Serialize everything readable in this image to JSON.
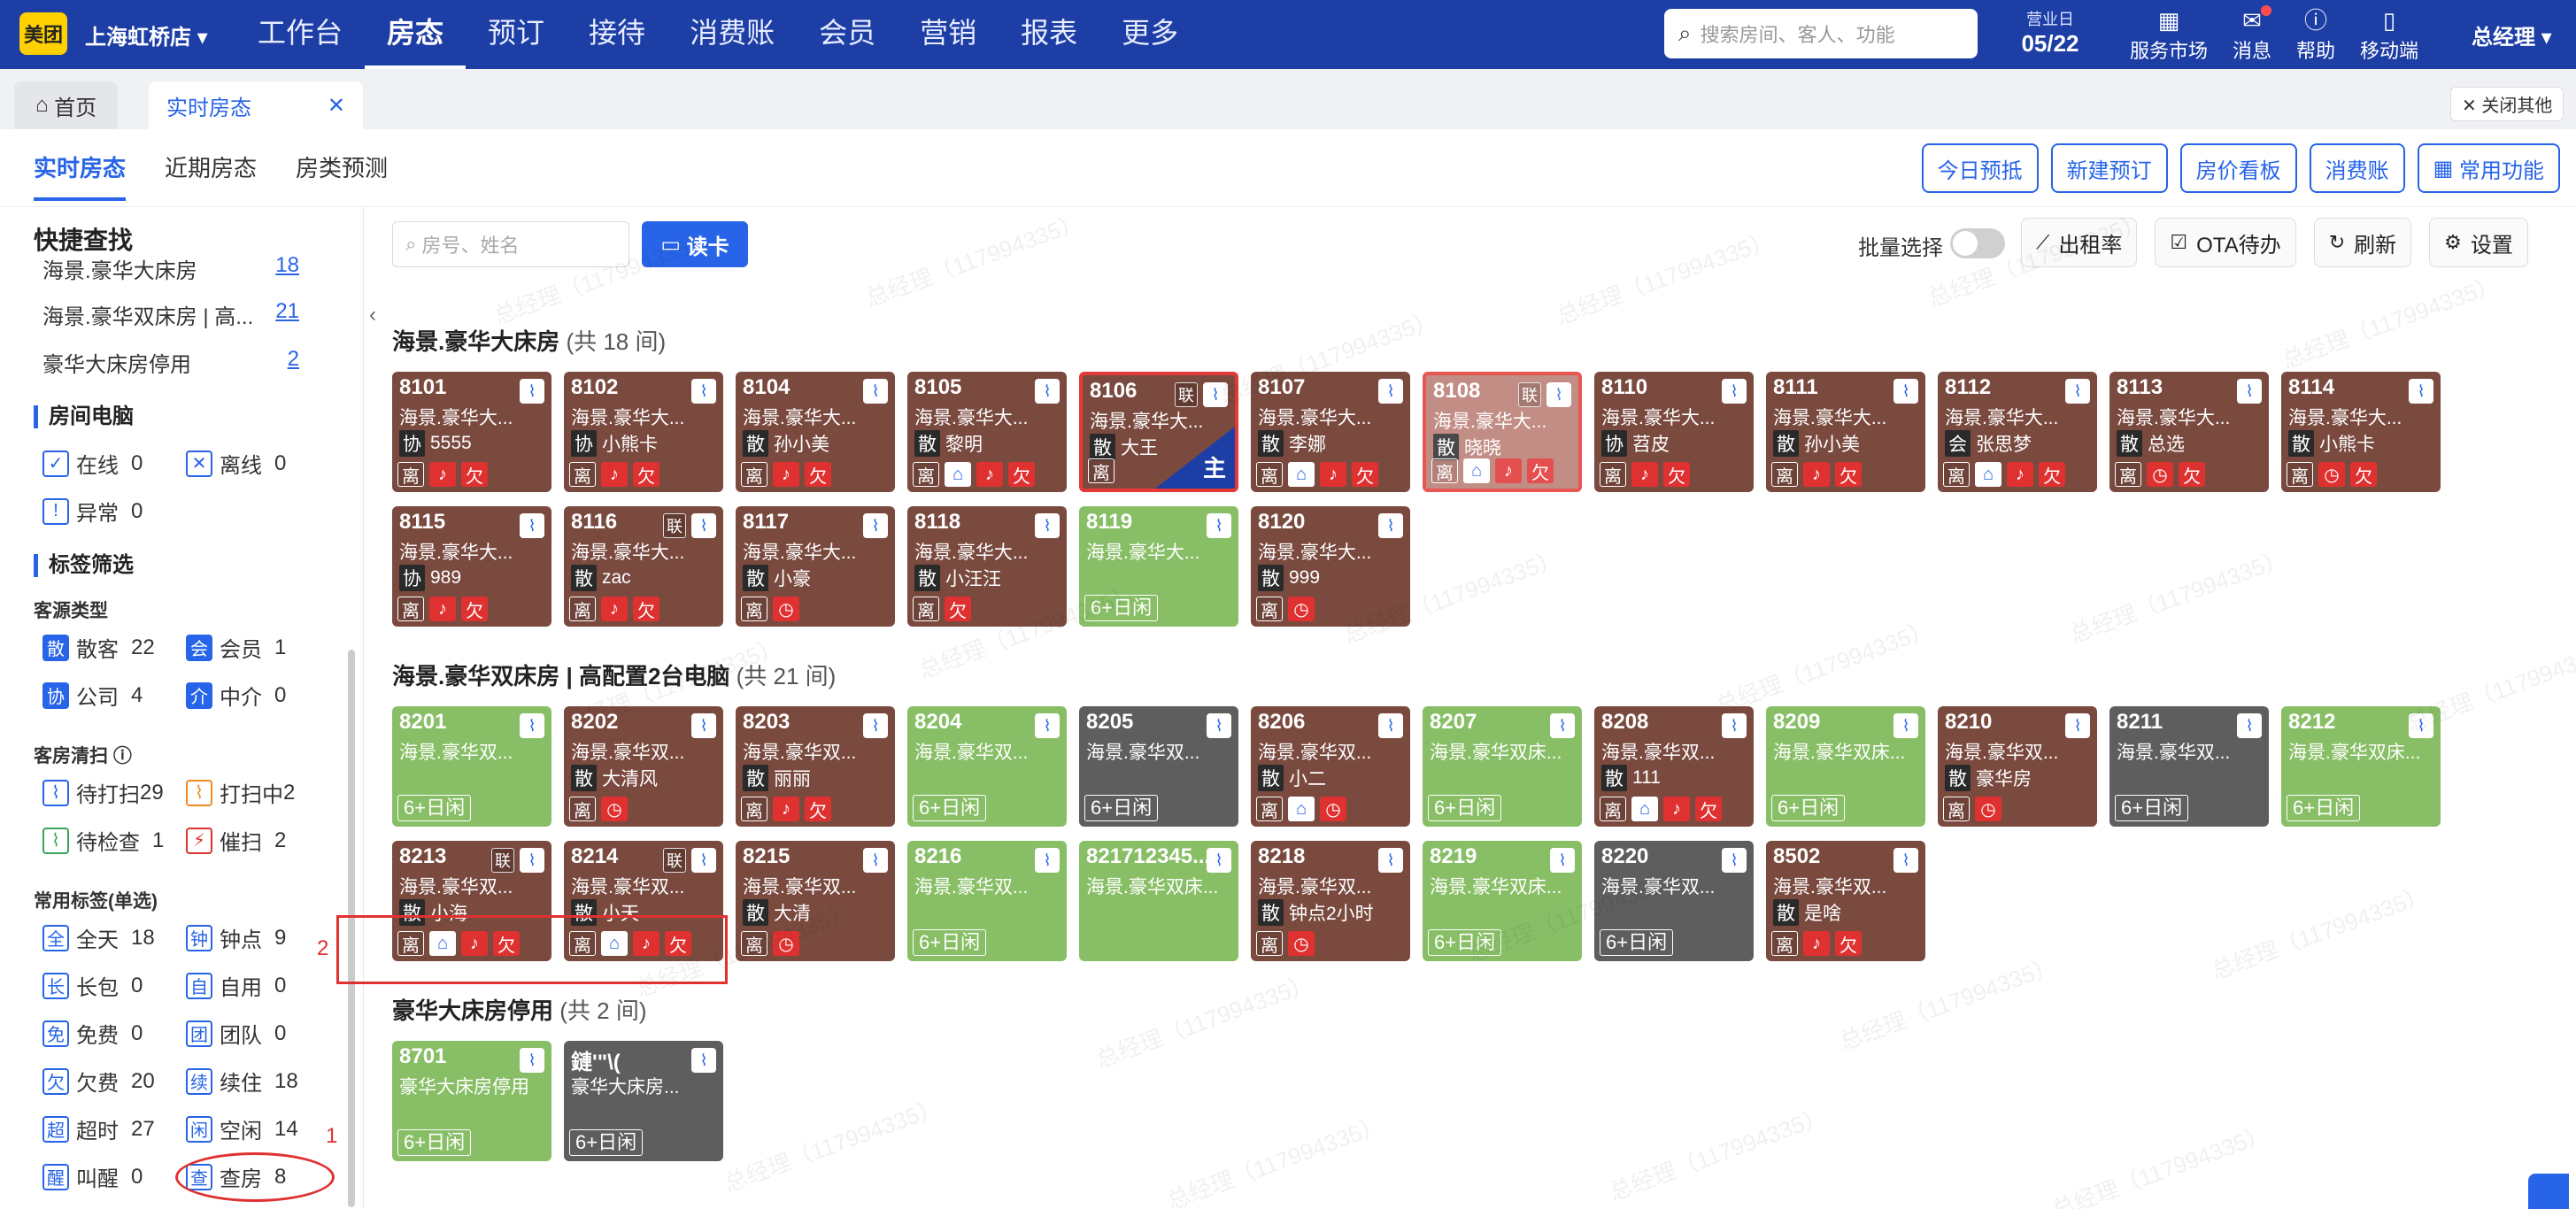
{
  "topbar": {
    "logo": "美团",
    "store": "上海虹桥店",
    "nav": [
      "工作台",
      "房态",
      "预订",
      "接待",
      "消费账",
      "会员",
      "营销",
      "报表",
      "更多"
    ],
    "search_placeholder": "搜索房间、客人、功能",
    "bizday_label": "营业日",
    "bizday": "05/22",
    "tools": [
      "服务市场",
      "消息",
      "帮助",
      "移动端"
    ],
    "user": "总经理"
  },
  "tabs": {
    "home": "首页",
    "current": "实时房态",
    "close_all": "关闭其他"
  },
  "subtabs": [
    "实时房态",
    "近期房态",
    "房类预测"
  ],
  "actions": [
    "今日预抵",
    "新建预订",
    "房价看板",
    "消费账",
    "常用功能"
  ],
  "side": {
    "title": "快捷查找",
    "quick": [
      {
        "name": "海景.豪华大床房",
        "n": "18"
      },
      {
        "name": "海景.豪华双床房 | 高...",
        "n": "21"
      },
      {
        "name": "豪华大床房停用",
        "n": "2"
      }
    ],
    "pc_title": "房间电脑",
    "pc": [
      {
        "t": "在线",
        "v": "0"
      },
      {
        "t": "离线",
        "v": "0"
      },
      {
        "t": "异常",
        "v": "0"
      }
    ],
    "tag_title": "标签筛选",
    "src_title": "客源类型",
    "src": [
      {
        "b": "散",
        "t": "散客",
        "v": "22"
      },
      {
        "b": "会",
        "t": "会员",
        "v": "1"
      },
      {
        "b": "协",
        "t": "公司",
        "v": "4"
      },
      {
        "b": "介",
        "t": "中介",
        "v": "0"
      }
    ],
    "clean_title": "客房清扫",
    "clean": [
      {
        "t": "待打扫",
        "v": "29"
      },
      {
        "t": "打扫中",
        "v": "2"
      },
      {
        "t": "待检查",
        "v": "1"
      },
      {
        "t": "催扫",
        "v": "2"
      }
    ],
    "common_title": "常用标签(单选)",
    "common": [
      {
        "b": "全",
        "t": "全天",
        "v": "18"
      },
      {
        "b": "钟",
        "t": "钟点",
        "v": "9"
      },
      {
        "b": "长",
        "t": "长包",
        "v": "0"
      },
      {
        "b": "自",
        "t": "自用",
        "v": "0"
      },
      {
        "b": "免",
        "t": "免费",
        "v": "0"
      },
      {
        "b": "团",
        "t": "团队",
        "v": "0"
      },
      {
        "b": "欠",
        "t": "欠费",
        "v": "20"
      },
      {
        "b": "续",
        "t": "续住",
        "v": "18"
      },
      {
        "b": "超",
        "t": "超时",
        "v": "27"
      },
      {
        "b": "闲",
        "t": "空闲",
        "v": "14"
      },
      {
        "b": "醒",
        "t": "叫醒",
        "v": "0"
      },
      {
        "b": "查",
        "t": "查房",
        "v": "8"
      }
    ]
  },
  "toolbar": {
    "search_placeholder": "房号、姓名",
    "read_card": "读卡",
    "batch": "批量选择",
    "buttons": [
      "出租率",
      "OTA待办",
      "刷新",
      "设置"
    ]
  },
  "groups": [
    {
      "name": "海景.豪华大床房",
      "count": "(共 18 间)"
    },
    {
      "name": "海景.豪华双床房 | 高配置2台电脑",
      "count": "(共 21 间)"
    },
    {
      "name": "豪华大床房停用",
      "count": "(共 2 间)"
    }
  ],
  "rooms": [
    {
      "num": "8101",
      "typ": "海景.豪华大...",
      "src": "协",
      "guest": "5555",
      "tags": [
        "离",
        "铃",
        "欠"
      ],
      "c": "brown",
      "x": 0,
      "y": 0
    },
    {
      "num": "8102",
      "typ": "海景.豪华大...",
      "src": "协",
      "guest": "小熊卡",
      "tags": [
        "离",
        "铃",
        "欠"
      ],
      "c": "brown",
      "x": 1,
      "y": 0
    },
    {
      "num": "8104",
      "typ": "海景.豪华大...",
      "src": "散",
      "guest": "孙小美",
      "tags": [
        "离",
        "铃",
        "欠"
      ],
      "c": "brown",
      "x": 2,
      "y": 0
    },
    {
      "num": "8105",
      "typ": "海景.豪华大...",
      "src": "散",
      "guest": "黎明",
      "tags": [
        "离",
        "家",
        "铃",
        "欠"
      ],
      "c": "brown",
      "x": 3,
      "y": 0
    },
    {
      "num": "8106",
      "typ": "海景.豪华大...",
      "src": "散",
      "guest": "大王",
      "tags": [
        "离"
      ],
      "c": "brown red",
      "x": 4,
      "y": 0,
      "lian": "联",
      "zhu": "主"
    },
    {
      "num": "8107",
      "typ": "海景.豪华大...",
      "src": "散",
      "guest": "李娜",
      "tags": [
        "离",
        "家",
        "铃",
        "欠"
      ],
      "c": "brown",
      "x": 5,
      "y": 0
    },
    {
      "num": "8108",
      "typ": "海景.豪华大...",
      "src": "散",
      "guest": "晓晓",
      "tags": [
        "离",
        "家",
        "铃",
        "欠"
      ],
      "c": "fade red",
      "x": 6,
      "y": 0,
      "lian": "联"
    },
    {
      "num": "8110",
      "typ": "海景.豪华大...",
      "src": "协",
      "guest": "苕皮",
      "tags": [
        "离",
        "铃",
        "欠"
      ],
      "c": "brown",
      "x": 7,
      "y": 0
    },
    {
      "num": "8111",
      "typ": "海景.豪华大...",
      "src": "散",
      "guest": "孙小美",
      "tags": [
        "离",
        "铃",
        "欠"
      ],
      "c": "brown",
      "x": 8,
      "y": 0
    },
    {
      "num": "8112",
      "typ": "海景.豪华大...",
      "src": "会",
      "guest": "张思梦",
      "tags": [
        "离",
        "家",
        "铃",
        "欠"
      ],
      "c": "brown",
      "x": 9,
      "y": 0
    },
    {
      "num": "8113",
      "typ": "海景.豪华大...",
      "src": "散",
      "guest": "总选",
      "tags": [
        "离",
        "钟",
        "欠"
      ],
      "c": "brown",
      "x": 10,
      "y": 0
    },
    {
      "num": "8114",
      "typ": "海景.豪华大...",
      "src": "散",
      "guest": "小熊卡",
      "tags": [
        "离",
        "钟",
        "欠"
      ],
      "c": "brown",
      "x": 11,
      "y": 0
    },
    {
      "num": "8115",
      "typ": "海景.豪华大...",
      "src": "协",
      "guest": "989",
      "tags": [
        "离",
        "铃",
        "欠"
      ],
      "c": "brown",
      "x": 0,
      "y": 1
    },
    {
      "num": "8116",
      "typ": "海景.豪华大...",
      "src": "散",
      "guest": "zac",
      "tags": [
        "离",
        "铃",
        "欠"
      ],
      "c": "brown",
      "x": 1,
      "y": 1,
      "lian": "联"
    },
    {
      "num": "8117",
      "typ": "海景.豪华大...",
      "src": "散",
      "guest": "小豪",
      "tags": [
        "离",
        "钟"
      ],
      "c": "brown",
      "x": 2,
      "y": 1
    },
    {
      "num": "8118",
      "typ": "海景.豪华大...",
      "src": "散",
      "guest": "小汪汪",
      "tags": [
        "离",
        "欠"
      ],
      "c": "brown",
      "x": 3,
      "y": 1
    },
    {
      "num": "8119",
      "typ": "海景.豪华大...",
      "idle": "6+日闲",
      "c": "green",
      "x": 4,
      "y": 1
    },
    {
      "num": "8120",
      "typ": "海景.豪华大...",
      "src": "散",
      "guest": "999",
      "tags": [
        "离",
        "钟"
      ],
      "c": "brown",
      "x": 5,
      "y": 1
    },
    {
      "num": "8201",
      "typ": "海景.豪华双...",
      "idle": "6+日闲",
      "c": "green",
      "x": 0,
      "y": 2
    },
    {
      "num": "8202",
      "typ": "海景.豪华双...",
      "src": "散",
      "guest": "大清风",
      "tags": [
        "离",
        "钟"
      ],
      "c": "brown",
      "x": 1,
      "y": 2
    },
    {
      "num": "8203",
      "typ": "海景.豪华双...",
      "src": "散",
      "guest": "丽丽",
      "tags": [
        "离",
        "铃",
        "欠"
      ],
      "c": "brown",
      "x": 2,
      "y": 2
    },
    {
      "num": "8204",
      "typ": "海景.豪华双...",
      "idle": "6+日闲",
      "c": "green",
      "x": 3,
      "y": 2
    },
    {
      "num": "8205",
      "typ": "海景.豪华双...",
      "idle": "6+日闲",
      "c": "gray",
      "x": 4,
      "y": 2
    },
    {
      "num": "8206",
      "typ": "海景.豪华双...",
      "src": "散",
      "guest": "小二",
      "tags": [
        "离",
        "家",
        "钟"
      ],
      "c": "brown",
      "x": 5,
      "y": 2
    },
    {
      "num": "8207",
      "typ": "海景.豪华双床...",
      "idle": "6+日闲",
      "c": "green",
      "x": 6,
      "y": 2
    },
    {
      "num": "8208",
      "typ": "海景.豪华双...",
      "src": "散",
      "guest": "111",
      "tags": [
        "离",
        "家",
        "铃",
        "欠"
      ],
      "c": "brown",
      "x": 7,
      "y": 2
    },
    {
      "num": "8209",
      "typ": "海景.豪华双床...",
      "idle": "6+日闲",
      "c": "green",
      "x": 8,
      "y": 2
    },
    {
      "num": "8210",
      "typ": "海景.豪华双...",
      "src": "散",
      "guest": "豪华房",
      "tags": [
        "离",
        "钟"
      ],
      "c": "brown",
      "x": 9,
      "y": 2
    },
    {
      "num": "8211",
      "typ": "海景.豪华双...",
      "idle": "6+日闲",
      "c": "gray",
      "x": 10,
      "y": 2
    },
    {
      "num": "8212",
      "typ": "海景.豪华双床...",
      "idle": "6+日闲",
      "c": "green",
      "x": 11,
      "y": 2
    },
    {
      "num": "8213",
      "typ": "海景.豪华双...",
      "src": "散",
      "guest": "小海",
      "tags": [
        "离",
        "家",
        "铃",
        "欠"
      ],
      "c": "brown",
      "x": 0,
      "y": 3,
      "lian": "联"
    },
    {
      "num": "8214",
      "typ": "海景.豪华双...",
      "src": "散",
      "guest": "小天",
      "tags": [
        "离",
        "家",
        "铃",
        "欠"
      ],
      "c": "brown",
      "x": 1,
      "y": 3,
      "lian": "联"
    },
    {
      "num": "8215",
      "typ": "海景.豪华双...",
      "src": "散",
      "guest": "大清",
      "tags": [
        "离",
        "钟"
      ],
      "c": "brown",
      "x": 2,
      "y": 3
    },
    {
      "num": "8216",
      "typ": "海景.豪华双...",
      "idle": "6+日闲",
      "c": "green",
      "x": 3,
      "y": 3
    },
    {
      "num": "821712345...",
      "typ": "海景.豪华双床...",
      "c": "green",
      "x": 4,
      "y": 3
    },
    {
      "num": "8218",
      "typ": "海景.豪华双...",
      "src": "散",
      "guest": "钟点2小时",
      "tags": [
        "离",
        "钟"
      ],
      "c": "brown",
      "x": 5,
      "y": 3
    },
    {
      "num": "8219",
      "typ": "海景.豪华双床...",
      "idle": "6+日闲",
      "c": "green",
      "x": 6,
      "y": 3
    },
    {
      "num": "8220",
      "typ": "海景.豪华双...",
      "idle": "6+日闲",
      "c": "gray",
      "x": 7,
      "y": 3
    },
    {
      "num": "8502",
      "typ": "海景.豪华双...",
      "src": "散",
      "guest": "是啥",
      "tags": [
        "离",
        "铃",
        "欠"
      ],
      "c": "brown",
      "x": 8,
      "y": 3
    },
    {
      "num": "8701",
      "typ": "豪华大床房停用",
      "idle": "6+日闲",
      "c": "green",
      "x": 0,
      "y": 4
    },
    {
      "num": "鏈'\"\\(",
      "typ": "豪华大床房...",
      "idle": "6+日闲",
      "c": "gray",
      "x": 1,
      "y": 4
    }
  ],
  "annotations": {
    "a1": "1",
    "a2": "2"
  },
  "watermark": "总经理（117994335）"
}
